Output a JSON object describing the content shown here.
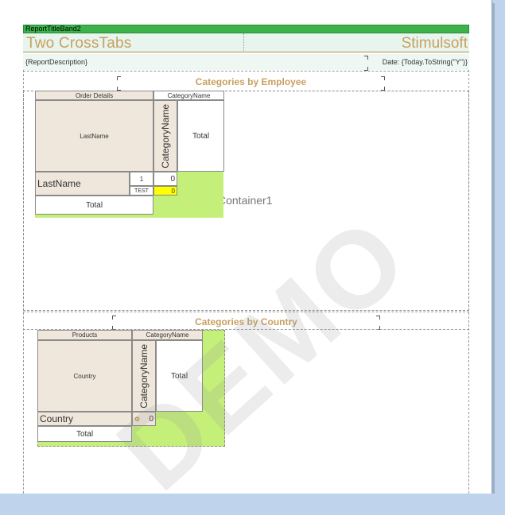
{
  "report": {
    "band_name": "ReportTitleBand2",
    "title": "Two CrossTabs",
    "brand": "Stimulsoft",
    "description": "{ReportDescription}",
    "date_expr": "Date: {Today.ToString(\"Y\")}"
  },
  "section1": {
    "title": "Categories by Employee",
    "container_label": "Container1",
    "crosstab": {
      "corner_label": "Order Details",
      "column_header": "CategoryName",
      "row_field_header": "LastName",
      "column_vertical": "CategoryName",
      "column_total": "Total",
      "row_label": "LastName",
      "row_values": [
        "1",
        "TEST"
      ],
      "cell_values": [
        "0",
        "0"
      ],
      "row_total": "Total"
    }
  },
  "section2": {
    "title": "Categories by Country",
    "crosstab": {
      "corner_label": "Products",
      "column_header": "CategoryName",
      "row_field_header": "Country",
      "column_vertical": "CategoryName",
      "column_total": "Total",
      "row_label": "Country",
      "cell_value": "0",
      "row_total": "Total"
    }
  },
  "watermark": "DEMO",
  "colors": {
    "band_green": "#3cb34a",
    "title_gold": "#c8a060",
    "cell_beige": "#efe7db",
    "cell_green": "#c4f07a",
    "highlight_yellow": "#ffff00",
    "background": "#bfd4ec"
  }
}
